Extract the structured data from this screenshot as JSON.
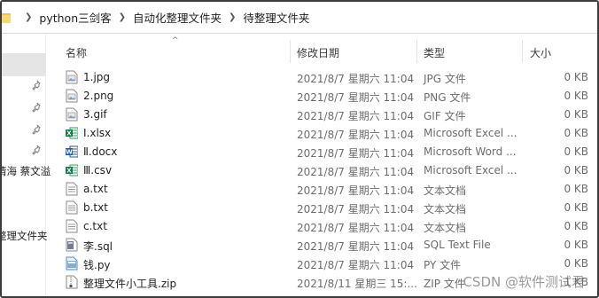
{
  "breadcrumb": [
    "python三剑客",
    "自动化整理文件夹",
    "待整理文件夹"
  ],
  "nav": {
    "fragment_1": "情海 蔡文溢",
    "fragment_2": "整理文件夹"
  },
  "columns": {
    "name": "名称",
    "date": "修改日期",
    "type": "类型",
    "size": "大小"
  },
  "files": [
    {
      "name": "1.jpg",
      "date": "2021/8/7 星期六 11:04",
      "type": "JPG 文件",
      "size": "0 KB",
      "icon": "image-file-icon"
    },
    {
      "name": "2.png",
      "date": "2021/8/7 星期六 11:04",
      "type": "PNG 文件",
      "size": "0 KB",
      "icon": "image-file-icon"
    },
    {
      "name": "3.gif",
      "date": "2021/8/7 星期六 11:04",
      "type": "GIF 文件",
      "size": "0 KB",
      "icon": "image-file-icon"
    },
    {
      "name": "Ⅰ.xlsx",
      "date": "2021/8/7 星期六 11:04",
      "type": "Microsoft Excel ...",
      "size": "0 KB",
      "icon": "excel-file-icon"
    },
    {
      "name": "Ⅱ.docx",
      "date": "2021/8/7 星期六 11:04",
      "type": "Microsoft Word ...",
      "size": "0 KB",
      "icon": "word-file-icon"
    },
    {
      "name": "Ⅲ.csv",
      "date": "2021/8/7 星期六 11:04",
      "type": "Microsoft Excel ...",
      "size": "0 KB",
      "icon": "excel-file-icon"
    },
    {
      "name": "a.txt",
      "date": "2021/8/7 星期六 11:04",
      "type": "文本文档",
      "size": "0 KB",
      "icon": "text-file-icon"
    },
    {
      "name": "b.txt",
      "date": "2021/8/7 星期六 11:04",
      "type": "文本文档",
      "size": "0 KB",
      "icon": "text-file-icon"
    },
    {
      "name": "c.txt",
      "date": "2021/8/7 星期六 11:04",
      "type": "文本文档",
      "size": "0 KB",
      "icon": "text-file-icon"
    },
    {
      "name": "李.sql",
      "date": "2021/8/7 星期六 11:04",
      "type": "SQL Text File",
      "size": "0 KB",
      "icon": "sql-file-icon"
    },
    {
      "name": "钱.py",
      "date": "2021/8/7 星期六 11:04",
      "type": "PY 文件",
      "size": "0 KB",
      "icon": "python-file-icon"
    },
    {
      "name": "整理文件小工具.zip",
      "date": "2021/8/11 星期三 15:...",
      "type": "ZIP 文件",
      "size": "1 KB",
      "icon": "zip-file-icon"
    }
  ],
  "watermark": "CSDN @软件测试君"
}
